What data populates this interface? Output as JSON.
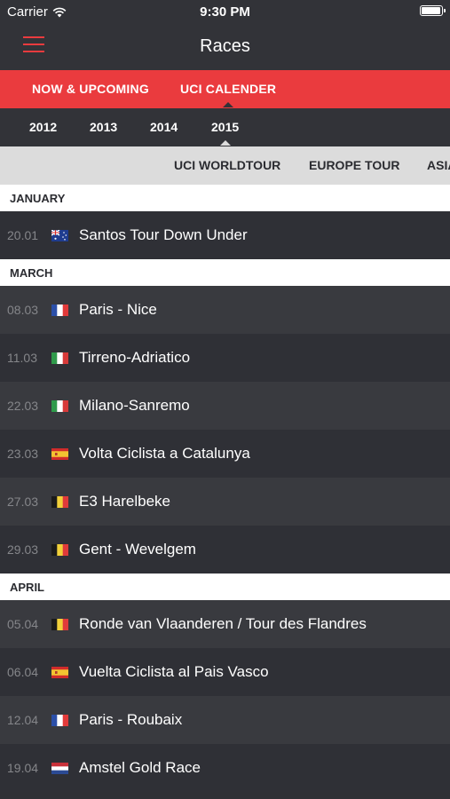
{
  "status_bar": {
    "carrier": "Carrier",
    "time": "9:30 PM",
    "battery_level": 1.0
  },
  "nav": {
    "title": "Races"
  },
  "tabs": [
    {
      "label": "NOW & UPCOMING",
      "active": false
    },
    {
      "label": "UCI CALENDER",
      "active": true
    }
  ],
  "years": [
    "2012",
    "2013",
    "2014",
    "2015"
  ],
  "selected_year": "2015",
  "tours": [
    "UCI WORLDTOUR",
    "EUROPE TOUR",
    "ASIA"
  ],
  "months": [
    {
      "name": "JANUARY",
      "races": [
        {
          "date": "20.01",
          "flag": "australia-flag-icon",
          "name": "Santos Tour Down Under"
        }
      ]
    },
    {
      "name": "MARCH",
      "races": [
        {
          "date": "08.03",
          "flag": "france-flag-icon",
          "name": "Paris - Nice"
        },
        {
          "date": "11.03",
          "flag": "italy-flag-icon",
          "name": "Tirreno-Adriatico"
        },
        {
          "date": "22.03",
          "flag": "italy-flag-icon",
          "name": "Milano-Sanremo"
        },
        {
          "date": "23.03",
          "flag": "spain-flag-icon",
          "name": "Volta Ciclista a Catalunya"
        },
        {
          "date": "27.03",
          "flag": "belgium-flag-icon",
          "name": "E3 Harelbeke"
        },
        {
          "date": "29.03",
          "flag": "belgium-flag-icon",
          "name": "Gent - Wevelgem"
        }
      ]
    },
    {
      "name": "APRIL",
      "races": [
        {
          "date": "05.04",
          "flag": "belgium-flag-icon",
          "name": "Ronde van Vlaanderen / Tour des Flandres"
        },
        {
          "date": "06.04",
          "flag": "spain-flag-icon",
          "name": "Vuelta Ciclista al Pais Vasco"
        },
        {
          "date": "12.04",
          "flag": "france-flag-icon",
          "name": "Paris - Roubaix"
        },
        {
          "date": "19.04",
          "flag": "netherlands-flag-icon",
          "name": "Amstel Gold Race"
        }
      ]
    }
  ],
  "colors": {
    "accent": "#ea3b3e",
    "background": "#2f3035",
    "header": "#323338",
    "tour_bar": "#dcdcdc"
  }
}
